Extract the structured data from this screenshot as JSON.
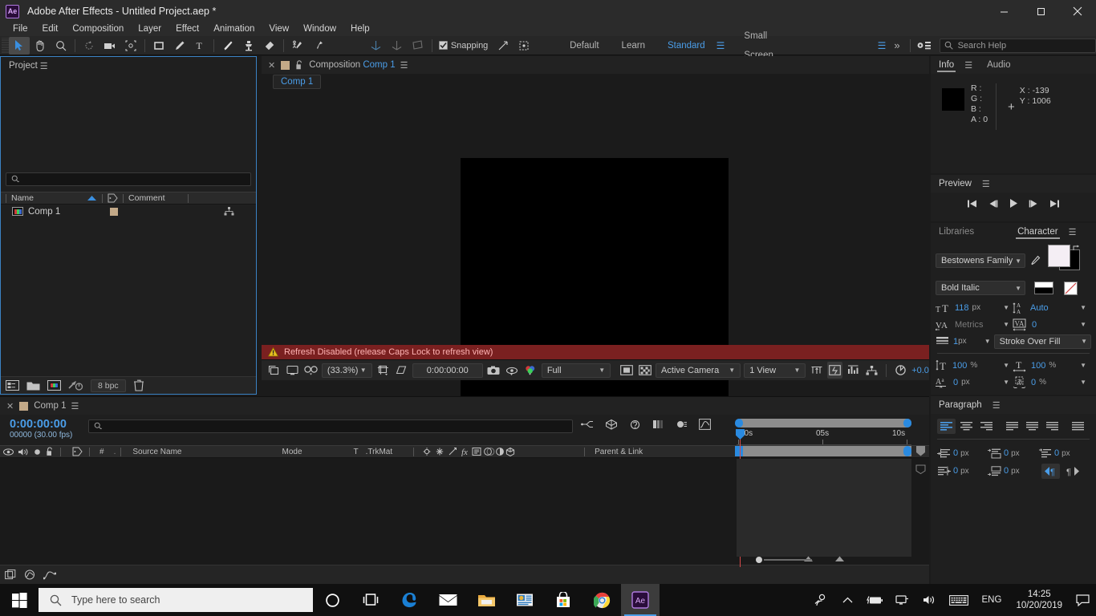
{
  "titlebar": {
    "logo": "Ae",
    "title": "Adobe After Effects - Untitled Project.aep *",
    "minimize": "minimize-icon",
    "maximize": "maximize-icon",
    "close": "close-icon"
  },
  "menubar": {
    "items": [
      {
        "label": "File"
      },
      {
        "label": "Edit"
      },
      {
        "label": "Composition"
      },
      {
        "label": "Layer"
      },
      {
        "label": "Effect"
      },
      {
        "label": "Animation"
      },
      {
        "label": "View"
      },
      {
        "label": "Window"
      },
      {
        "label": "Help"
      }
    ]
  },
  "toolbar": {
    "tools": [
      {
        "name": "selection-tool",
        "active": true
      },
      {
        "name": "hand-tool",
        "active": false
      },
      {
        "name": "zoom-tool",
        "active": false
      },
      {
        "name": "rotation-tool",
        "active": false
      },
      {
        "name": "camera-tool",
        "active": false
      },
      {
        "name": "pan-behind-tool",
        "active": false
      },
      {
        "name": "shape-tool",
        "active": false
      },
      {
        "name": "pen-tool",
        "active": false
      },
      {
        "name": "type-tool",
        "active": false
      },
      {
        "name": "brush-tool",
        "active": false
      },
      {
        "name": "clone-stamp-tool",
        "active": false
      },
      {
        "name": "eraser-tool",
        "active": false
      },
      {
        "name": "roto-brush-tool",
        "active": false
      },
      {
        "name": "puppet-pin-tool",
        "active": false
      }
    ],
    "snapping_label": "Snapping",
    "snapping_checked": true,
    "workspaces": [
      {
        "label": "Default",
        "selected": false
      },
      {
        "label": "Learn",
        "selected": false
      },
      {
        "label": "Standard",
        "selected": true
      },
      {
        "label": "Small Screen",
        "selected": false
      }
    ],
    "overflow": "»",
    "search_placeholder": "Search Help"
  },
  "project": {
    "title": "Project",
    "search_value": "",
    "columns": [
      "Name",
      "Comment"
    ],
    "sort_indicator": "ascending",
    "rows": [
      {
        "name": "Comp 1",
        "label_color": "#c3a988",
        "type": "composition"
      }
    ],
    "footer": {
      "bit_depth": "8 bpc",
      "buttons": [
        "new-folder-icon",
        "new-comp-icon",
        "project-settings-icon",
        "delete-icon"
      ]
    }
  },
  "composition": {
    "tab_prefix": "Composition",
    "tab_name": "Comp 1",
    "breadcrumb": "Comp 1",
    "warning": "Refresh Disabled (release Caps Lock to refresh view)",
    "toolbar": {
      "zoom": "(33.3%)",
      "timecode": "0:00:00:00",
      "resolution": "Full",
      "camera": "Active Camera",
      "views": "1 View",
      "exposure": "+0.0"
    }
  },
  "info": {
    "tabs": [
      {
        "label": "Info",
        "selected": true
      },
      {
        "label": "Audio",
        "selected": false
      }
    ],
    "channels": [
      {
        "label": "R :",
        "value": ""
      },
      {
        "label": "G :",
        "value": ""
      },
      {
        "label": "B :",
        "value": ""
      },
      {
        "label": "A :",
        "value": "0"
      }
    ],
    "coords": [
      {
        "label": "X :",
        "value": "-139"
      },
      {
        "label": "Y :",
        "value": "1006"
      }
    ]
  },
  "preview": {
    "title": "Preview",
    "transport": [
      "first-frame-icon",
      "previous-frame-icon",
      "play-icon",
      "next-frame-icon",
      "last-frame-icon"
    ]
  },
  "character": {
    "tabs": [
      {
        "label": "Libraries",
        "selected": false
      },
      {
        "label": "Character",
        "selected": true
      }
    ],
    "font_family": "Bestowens Family",
    "font_style": "Bold Italic",
    "font_size": "118",
    "font_size_unit": "px",
    "leading": "Auto",
    "kerning": "Metrics",
    "tracking": "0",
    "stroke_width": "1",
    "stroke_width_unit": "px",
    "stroke_order": "Stroke Over Fill",
    "vertical_scale": "100",
    "vertical_scale_unit": "%",
    "horizontal_scale": "100",
    "horizontal_scale_unit": "%",
    "baseline_shift": "0",
    "baseline_shift_unit": "px",
    "tsume": "0",
    "tsume_unit": "%"
  },
  "paragraph": {
    "title": "Paragraph",
    "alignments": [
      {
        "name": "align-left",
        "selected": true
      },
      {
        "name": "align-center",
        "selected": false
      },
      {
        "name": "align-right",
        "selected": false
      },
      {
        "name": "justify-last-left",
        "selected": false
      },
      {
        "name": "justify-last-center",
        "selected": false
      },
      {
        "name": "justify-last-right",
        "selected": false
      },
      {
        "name": "justify-all",
        "selected": false
      }
    ],
    "indents": [
      {
        "name": "indent-left",
        "value": "0",
        "unit": "px"
      },
      {
        "name": "space-before",
        "value": "0",
        "unit": "px"
      },
      {
        "name": "indent-first-line",
        "value": "0",
        "unit": "px"
      },
      {
        "name": "indent-right",
        "value": "0",
        "unit": "px"
      },
      {
        "name": "space-after",
        "value": "0",
        "unit": "px"
      }
    ],
    "direction": [
      {
        "name": "ltr-direction",
        "selected": true
      },
      {
        "name": "rtl-direction",
        "selected": false
      }
    ]
  },
  "timeline": {
    "tab_name": "Comp 1",
    "timecode": "0:00:00:00",
    "frames": "00000 (30.00 fps)",
    "search_value": "",
    "columns": [
      "Source Name",
      "Mode",
      "T",
      "TrkMat",
      "Parent & Link"
    ],
    "ruler_labels": [
      "00s",
      "05s",
      "10s"
    ],
    "rows": []
  },
  "taskbar": {
    "search_placeholder": "Type here to search",
    "apps": [
      {
        "name": "cortana-icon"
      },
      {
        "name": "task-view-icon"
      },
      {
        "name": "edge-icon"
      },
      {
        "name": "mail-icon"
      },
      {
        "name": "file-explorer-icon"
      },
      {
        "name": "office-icon"
      },
      {
        "name": "microsoft-store-icon"
      },
      {
        "name": "chrome-icon"
      },
      {
        "name": "after-effects-icon",
        "active": true
      }
    ],
    "language": "ENG",
    "time": "14:25",
    "date": "10/20/2019"
  },
  "colors": {
    "accent_blue": "#4a9de8",
    "warning_red": "#7a2020",
    "label_tan": "#c3a988",
    "panel_bg": "#1f1f1f"
  }
}
